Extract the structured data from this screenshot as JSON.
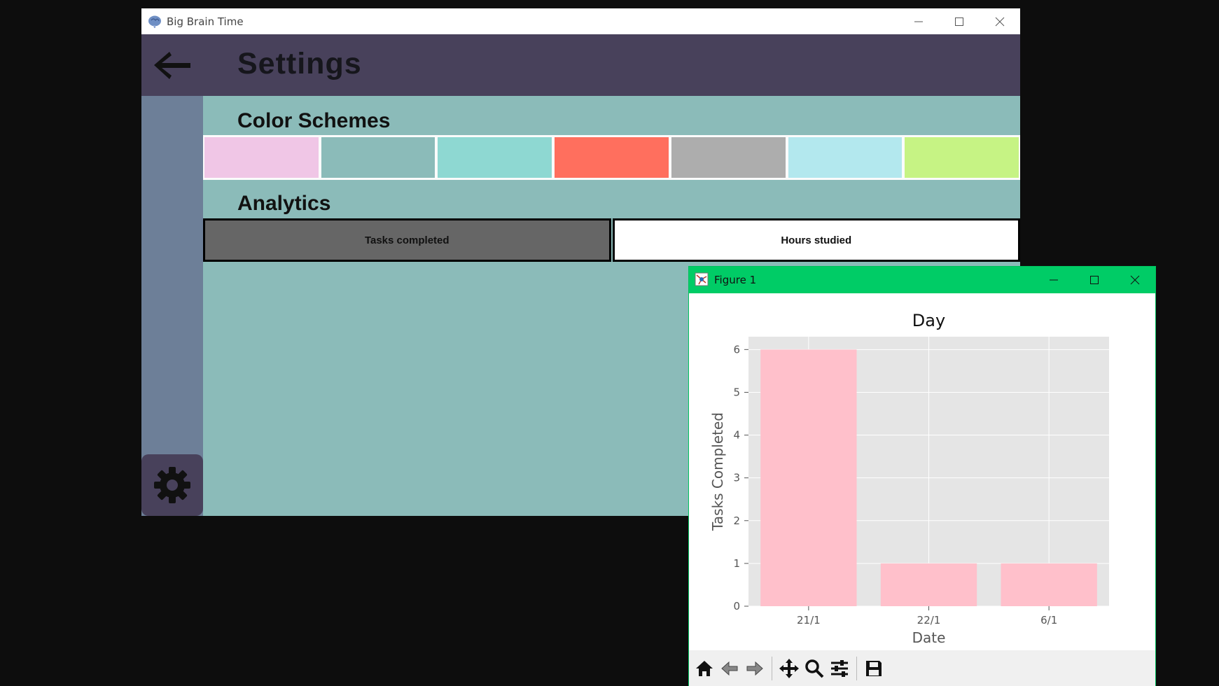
{
  "app_window": {
    "title": "Big Brain Time",
    "icon": "brain-icon",
    "page_title": "Settings",
    "color_schemes_title": "Color Schemes",
    "analytics_title": "Analytics",
    "swatches": [
      {
        "name": "pink",
        "color": "#f0c6e6"
      },
      {
        "name": "sage",
        "color": "#8bbbb9"
      },
      {
        "name": "teal",
        "color": "#8ed8d2"
      },
      {
        "name": "coral",
        "color": "#ff6f5e"
      },
      {
        "name": "gray",
        "color": "#adadad"
      },
      {
        "name": "light-blue",
        "color": "#b3e8ee"
      },
      {
        "name": "lime",
        "color": "#c6f384"
      }
    ],
    "tabs": [
      {
        "label": "Tasks completed",
        "active": true
      },
      {
        "label": "Hours studied",
        "active": false
      }
    ],
    "colors": {
      "header": "#48415b",
      "sidebar": "#6d7f98",
      "content": "#8bbbb9"
    }
  },
  "figure_window": {
    "title": "Figure 1",
    "colors": {
      "titlebar": "#00cc66",
      "bar": "#ffc0cb",
      "plot_bg": "#e5e5e5"
    },
    "toolbar": [
      "home-icon",
      "back-icon",
      "forward-icon",
      "pan-icon",
      "zoom-icon",
      "configure-icon",
      "save-icon"
    ]
  },
  "chart_data": {
    "type": "bar",
    "title": "Day",
    "xlabel": "Date",
    "ylabel": "Tasks Completed",
    "categories": [
      "21/1",
      "22/1",
      "6/1"
    ],
    "values": [
      6,
      1,
      1
    ],
    "ylim": [
      0,
      6.3
    ],
    "yticks": [
      0,
      1,
      2,
      3,
      4,
      5,
      6
    ],
    "grid": true
  }
}
